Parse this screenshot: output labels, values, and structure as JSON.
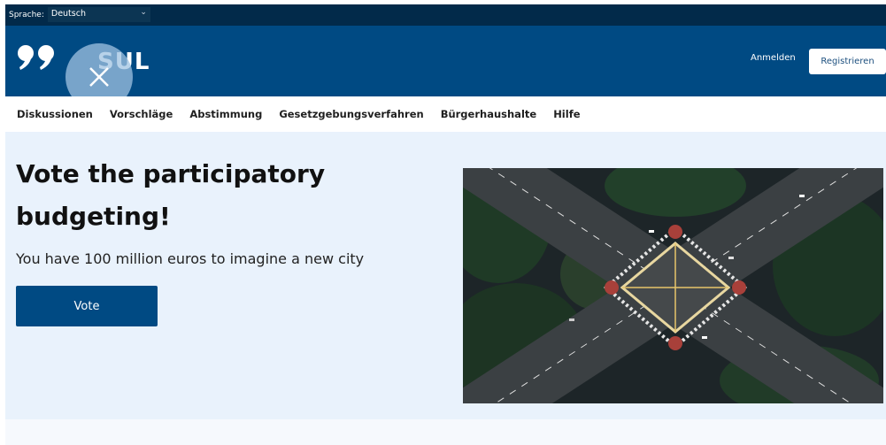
{
  "language_bar": {
    "label": "Sprache:",
    "selected": "Deutsch"
  },
  "header": {
    "logo_text": "SUL",
    "sign_in": "Anmelden",
    "register": "Registrieren"
  },
  "nav": {
    "items": [
      "Diskussionen",
      "Vorschläge",
      "Abstimmung",
      "Gesetzgebungsverfahren",
      "Bürgerhaushalte",
      "Hilfe"
    ]
  },
  "hero": {
    "title": "Vote the participatory budgeting!",
    "subtitle": "You have 100 million euros to imagine a new city",
    "button": "Vote",
    "image_icon": "aerial-intersection-photo"
  },
  "colors": {
    "brand_dark": "#022a4a",
    "brand": "#004a83",
    "hero_bg": "#e9f2fc"
  }
}
